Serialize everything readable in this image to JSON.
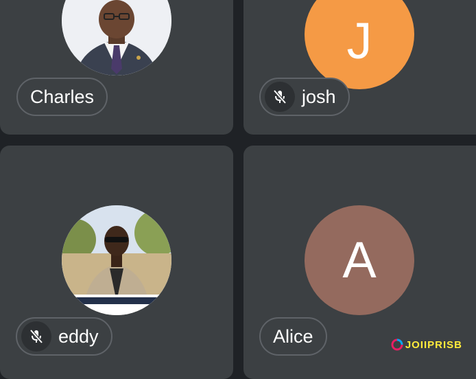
{
  "participants": [
    {
      "name": "Charles",
      "muted": false,
      "avatar_type": "photo",
      "photo_desc": "man-in-suit"
    },
    {
      "name": "josh",
      "muted": true,
      "avatar_type": "letter",
      "letter": "J",
      "avatar_color": "#f59a45"
    },
    {
      "name": "eddy",
      "muted": true,
      "avatar_type": "photo",
      "photo_desc": "man-in-beige-blazer-outdoors"
    },
    {
      "name": "Alice",
      "muted": false,
      "avatar_type": "letter",
      "letter": "A",
      "avatar_color": "#946a5e"
    }
  ],
  "icons": {
    "muted": "mic-off-icon"
  },
  "watermark": {
    "text": "JOIIPRISB"
  },
  "colors": {
    "tile_bg": "#3c4043",
    "page_bg": "#1f2226",
    "pill_border": "#5f6368"
  }
}
